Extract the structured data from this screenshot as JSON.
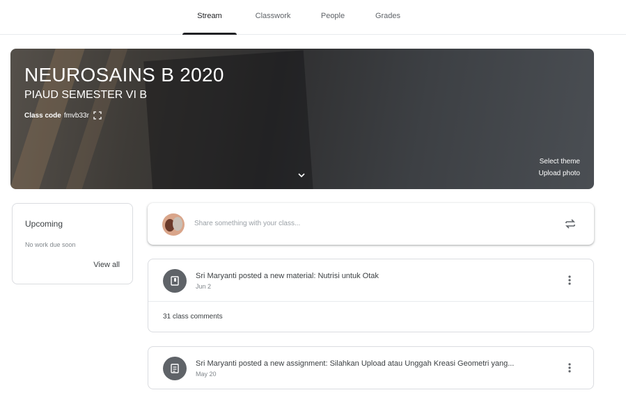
{
  "nav": {
    "tabs": [
      {
        "label": "Stream"
      },
      {
        "label": "Classwork"
      },
      {
        "label": "People"
      },
      {
        "label": "Grades"
      }
    ]
  },
  "banner": {
    "title": "NEUROSAINS B 2020",
    "section": "PIAUD SEMESTER VI B",
    "class_code_label": "Class code",
    "class_code": "fmvb33r",
    "select_theme": "Select theme",
    "upload_photo": "Upload photo"
  },
  "upcoming": {
    "title": "Upcoming",
    "empty_text": "No work due soon",
    "view_all": "View all"
  },
  "share": {
    "placeholder": "Share something with your class..."
  },
  "posts": [
    {
      "icon": "material-icon",
      "headline": "Sri Maryanti posted a new material: Nutrisi untuk Otak",
      "date": "Jun 2",
      "comments": "31 class comments"
    },
    {
      "icon": "assignment-icon",
      "headline": "Sri Maryanti posted a new assignment: Silahkan Upload atau Unggah Kreasi Geometri yang...",
      "date": "May 20"
    }
  ],
  "colors": {
    "accent": "#202124",
    "icon_circle": "#5f6368",
    "border": "#dadce0"
  }
}
